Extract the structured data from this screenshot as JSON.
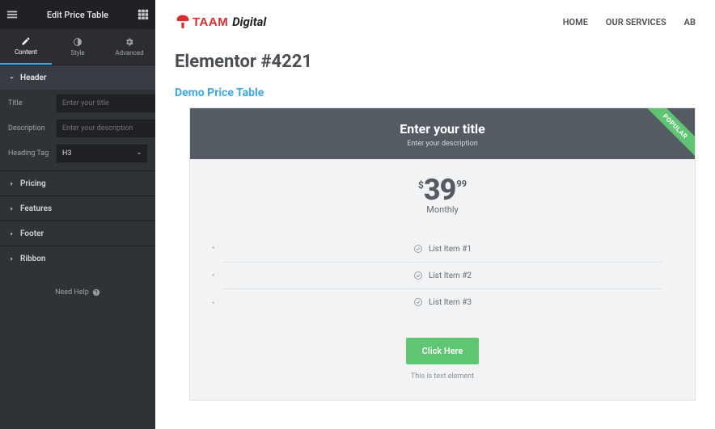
{
  "panel": {
    "title": "Edit Price Table",
    "tabs": {
      "content": "Content",
      "style": "Style",
      "advanced": "Advanced"
    },
    "sections": {
      "header": {
        "label": "Header",
        "title_label": "Title",
        "title_placeholder": "Enter your title",
        "desc_label": "Description",
        "desc_placeholder": "Enter your description",
        "tag_label": "Heading Tag",
        "tag_value": "H3"
      },
      "pricing": "Pricing",
      "features": "Features",
      "footer": "Footer",
      "ribbon": "Ribbon"
    },
    "need_help": "Need Help"
  },
  "site": {
    "logo_a": "TAAM",
    "logo_b": "Digital",
    "nav": {
      "home": "HOME",
      "services": "OUR SERVICES",
      "about": "AB"
    }
  },
  "page": {
    "title": "Elementor #4221",
    "demo_label": "Demo Price Table"
  },
  "card": {
    "title": "Enter your title",
    "desc": "Enter your description",
    "currency": "$",
    "price": "39",
    "cents": "99",
    "period": "Monthly",
    "features": {
      "f1": "List Item #1",
      "f2": "List Item #2",
      "f3": "List Item #3"
    },
    "cta": "Click Here",
    "caption": "This is text element",
    "ribbon": "POPULAR"
  }
}
